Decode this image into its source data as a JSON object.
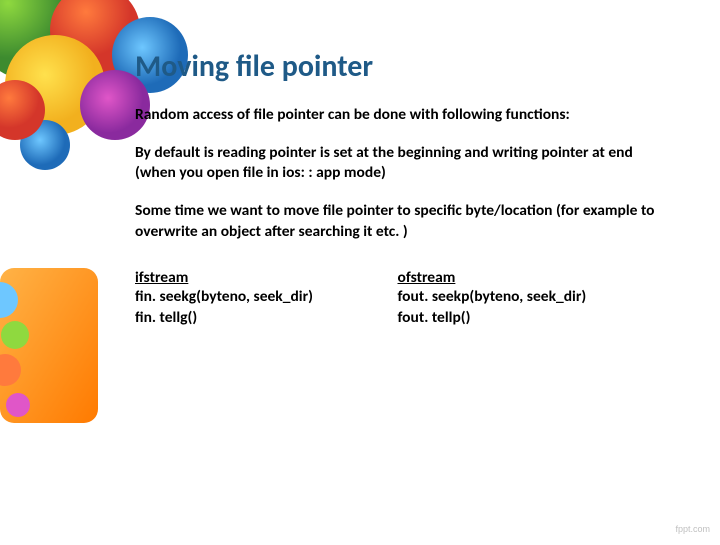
{
  "title": "Moving file pointer",
  "paragraphs": {
    "p1": "Random access of file pointer can be done with following functions:",
    "p2": "By default is reading pointer is set at the beginning and writing pointer at end (when you open file in ios: : app mode)",
    "p3": "Some time we want to move file pointer to specific byte/location (for example to overwrite an object after searching it etc. )"
  },
  "columns": {
    "left": {
      "header": "ifstream",
      "line1": "fin. seekg(byteno, seek_dir)",
      "line2": "fin. tellg()"
    },
    "right": {
      "header": "ofstream",
      "line1": "fout. seekp(byteno, seek_dir)",
      "line2": "fout. tellp()"
    }
  },
  "footer": "fppt.com"
}
